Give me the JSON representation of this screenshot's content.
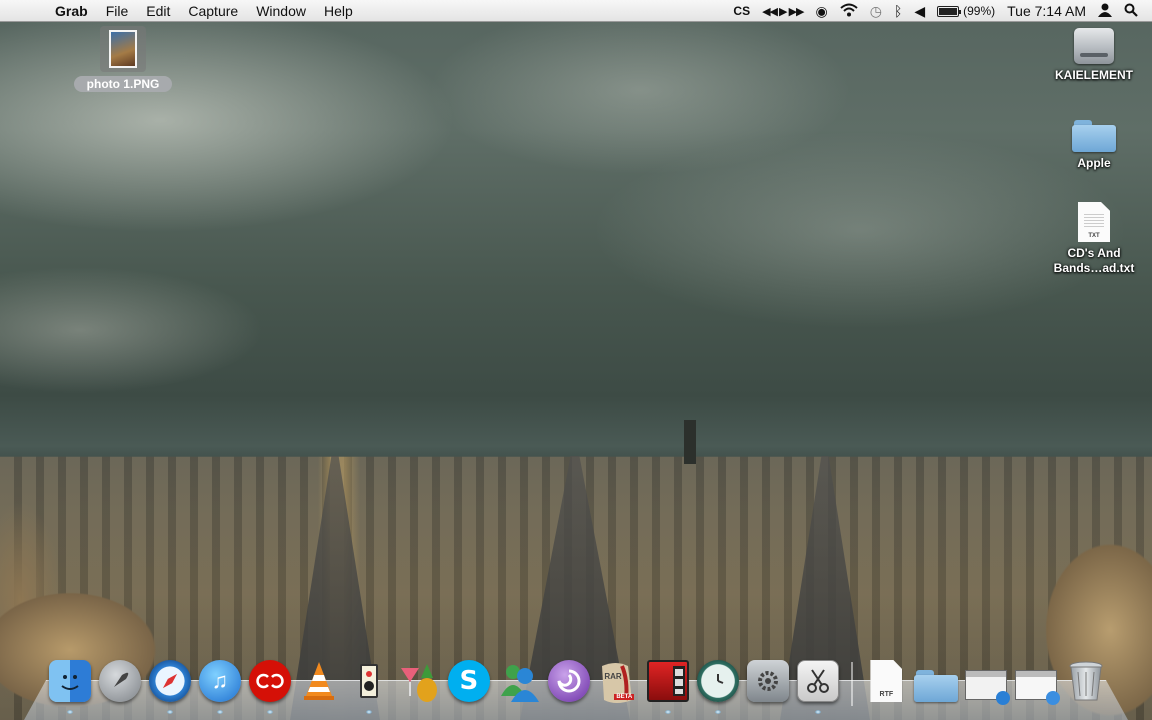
{
  "menubar": {
    "app_name": "Grab",
    "menus": [
      "File",
      "Edit",
      "Capture",
      "Window",
      "Help"
    ],
    "status": {
      "lastfm_label": "CS",
      "battery_text": "(99%)",
      "battery_level": 0.99,
      "clock": "Tue 7:14 AM"
    }
  },
  "desktop": {
    "selected_file": {
      "label": "photo 1.PNG"
    },
    "icons": [
      {
        "label": "KAIELEMENT",
        "kind": "hard-drive"
      },
      {
        "label": "Apple",
        "kind": "folder"
      },
      {
        "label": "CD's And Bands…ad.txt",
        "kind": "text-document",
        "ext": "TXT"
      }
    ]
  },
  "dock": {
    "rtf_ext": "RTF",
    "rar_label": "RAR",
    "beta_label": "BETA"
  },
  "colors": {
    "menubar": "#e9e9e9",
    "folder_blue": "#7db4de",
    "lastfm_red": "#d51007",
    "skype_blue": "#00aff0"
  }
}
